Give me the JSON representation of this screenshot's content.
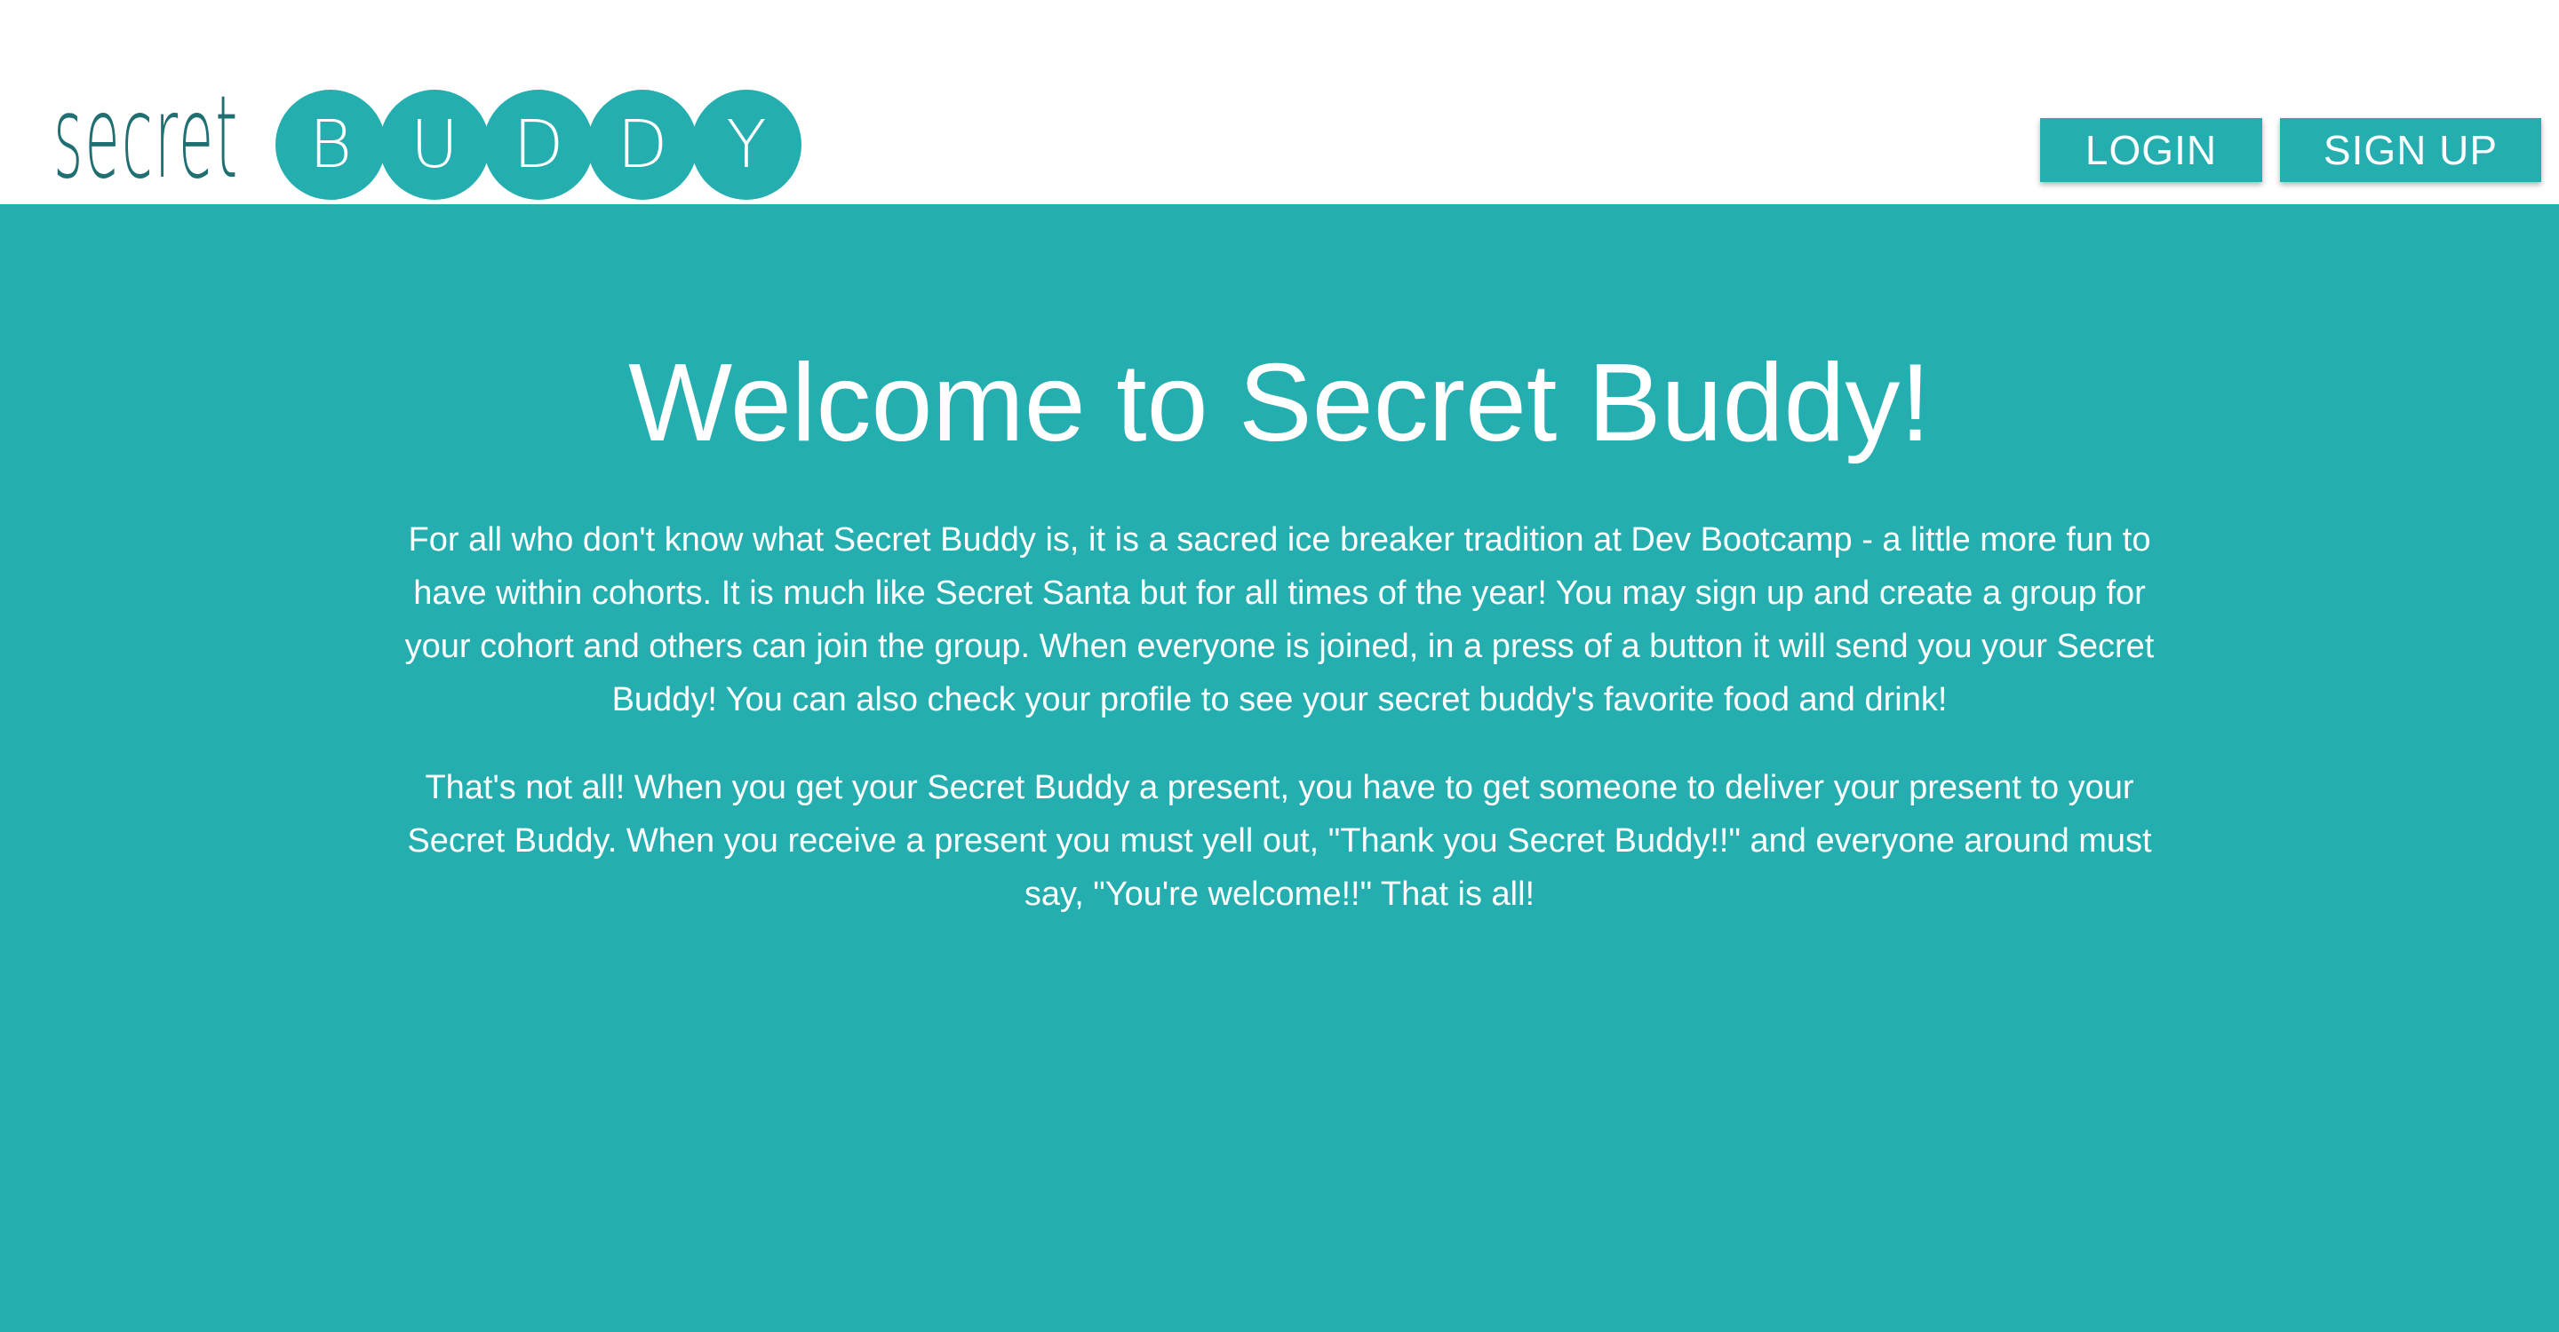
{
  "header": {
    "logo": {
      "secret_text": "secret",
      "buddy_letters": [
        "B",
        "U",
        "D",
        "D",
        "Y"
      ]
    },
    "nav": {
      "login_label": "LOGIN",
      "signup_label": "SIGN UP"
    }
  },
  "main": {
    "title": "Welcome to Secret Buddy!",
    "paragraphs": [
      "For all who don't know what Secret Buddy is, it is a sacred ice breaker tradition at Dev Bootcamp - a little more fun to have within cohorts. It is much like Secret Santa but for all times of the year! You may sign up and create a group for your cohort and others can join the group. When everyone is joined, in a press of a button it will send you your Secret Buddy! You can also check your profile to see your secret buddy's favorite food and drink!",
      "That's not all! When you get your Secret Buddy a present, you have to get someone to deliver your present to your Secret Buddy. When you receive a present you must yell out, \"Thank you Secret Buddy!!\" and everyone around must say, \"You're welcome!!\" That is all!"
    ]
  },
  "colors": {
    "accent": "#24aeaf",
    "logo_text": "#1f6f73",
    "background": "#ffffff",
    "text_on_accent": "#ffffff"
  }
}
